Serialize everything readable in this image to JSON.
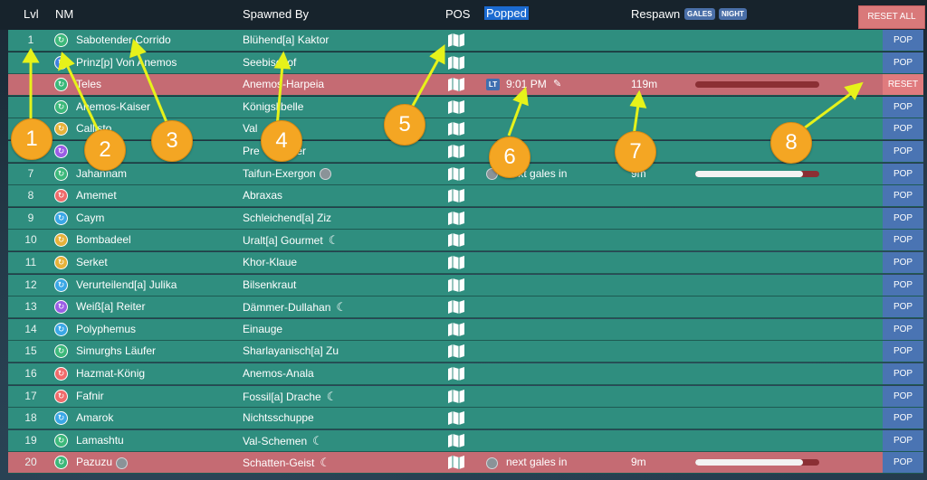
{
  "header": {
    "lvl": "Lvl",
    "nm": "NM",
    "spawned_by": "Spawned By",
    "pos": "POS",
    "popped": "Popped",
    "respawn": "Respawn",
    "gales_pill": "GALES",
    "night_pill": "NIGHT",
    "reset_all": "RESET ALL"
  },
  "rows": [
    {
      "lvl": "1",
      "nm": "Sabotender Corrido",
      "sb": "Blühend[a] Kaktor",
      "rank_color": "#3cb87a",
      "state": "green",
      "action": "POP"
    },
    {
      "lvl": "",
      "nm": "Prinz[p] Von Anemos",
      "sb": "Seebischof",
      "rank_color": "#3f80e0",
      "state": "green",
      "action": "POP"
    },
    {
      "lvl": "",
      "nm": "Teles",
      "sb": "Anemos-Harpeia",
      "rank_color": "#3cb87a",
      "state": "red",
      "action": "RESET",
      "lt": "LT",
      "popped_time": "9:01 PM",
      "respawn": "119m",
      "bar_fill": 0
    },
    {
      "lvl": "",
      "nm": "Anemos-Kaiser",
      "sb": "Königslibelle",
      "rank_color": "#3cb87a",
      "state": "green",
      "action": "POP"
    },
    {
      "lvl": "",
      "nm": "Callisto",
      "sb": "Val",
      "rank_color": "#e6b23a",
      "state": "green",
      "action": "POP"
    },
    {
      "lvl": "",
      "nm": "",
      "sb": "Pre",
      "sb_tail": "chinder",
      "rank_color": "#9b5de5",
      "state": "green",
      "action": "POP"
    },
    {
      "lvl": "7",
      "nm": "Jahannam",
      "sb": "Taifun-Exergon",
      "sb_weather": true,
      "rank_color": "#3cb87a",
      "state": "green",
      "action": "POP",
      "next_gales": "next gales in",
      "respawn": "9m",
      "bar_fill": 0.87
    },
    {
      "lvl": "8",
      "nm": "Amemet",
      "sb": "Abraxas",
      "rank_color": "#f06b6b",
      "state": "green",
      "action": "POP"
    },
    {
      "lvl": "9",
      "nm": "Caym",
      "sb": "Schleichend[a] Ziz",
      "rank_color": "#3aa7e6",
      "state": "green",
      "action": "POP"
    },
    {
      "lvl": "10",
      "nm": "Bombadeel",
      "sb": "Uralt[a] Gourmet",
      "moon": true,
      "rank_color": "#e6b23a",
      "state": "green",
      "action": "POP"
    },
    {
      "lvl": "11",
      "nm": "Serket",
      "sb": "Khor-Klaue",
      "rank_color": "#e6b23a",
      "state": "green",
      "action": "POP"
    },
    {
      "lvl": "12",
      "nm": "Verurteilend[a] Julika",
      "sb": "Bilsenkraut",
      "rank_color": "#3aa7e6",
      "state": "green",
      "action": "POP"
    },
    {
      "lvl": "13",
      "nm": "Weiß[a] Reiter",
      "sb": "Dämmer-Dullahan",
      "moon": true,
      "rank_color": "#9b5de5",
      "state": "green",
      "action": "POP"
    },
    {
      "lvl": "14",
      "nm": "Polyphemus",
      "sb": "Einauge",
      "rank_color": "#3aa7e6",
      "state": "green",
      "action": "POP"
    },
    {
      "lvl": "15",
      "nm": "Simurghs Läufer",
      "sb": "Sharlayanisch[a] Zu",
      "rank_color": "#3cb87a",
      "state": "green",
      "action": "POP"
    },
    {
      "lvl": "16",
      "nm": "Hazmat-König",
      "sb": "Anemos-Anala",
      "rank_color": "#f06b6b",
      "state": "green",
      "action": "POP"
    },
    {
      "lvl": "17",
      "nm": "Fafnir",
      "sb": "Fossil[a] Drache",
      "moon": true,
      "rank_color": "#f06b6b",
      "state": "green",
      "action": "POP"
    },
    {
      "lvl": "18",
      "nm": "Amarok",
      "sb": "Nichtsschuppe",
      "rank_color": "#3aa7e6",
      "state": "green",
      "action": "POP"
    },
    {
      "lvl": "19",
      "nm": "Lamashtu",
      "sb": "Val-Schemen",
      "moon": true,
      "rank_color": "#3cb87a",
      "state": "green",
      "action": "POP"
    },
    {
      "lvl": "20",
      "nm": "Pazuzu",
      "nm_weather": true,
      "sb": "Schatten-Geist",
      "moon": true,
      "rank_color": "#3cb87a",
      "state": "red",
      "action": "POP",
      "next_gales": "next gales in",
      "respawn": "9m",
      "bar_fill": 0.87
    }
  ],
  "callouts": [
    "1",
    "2",
    "3",
    "4",
    "5",
    "6",
    "7",
    "8"
  ],
  "icons": {
    "map": "map-icon",
    "moon": "moon-icon",
    "weather": "weather-icon",
    "edit": "edit-icon",
    "rank": "rank-icon"
  }
}
